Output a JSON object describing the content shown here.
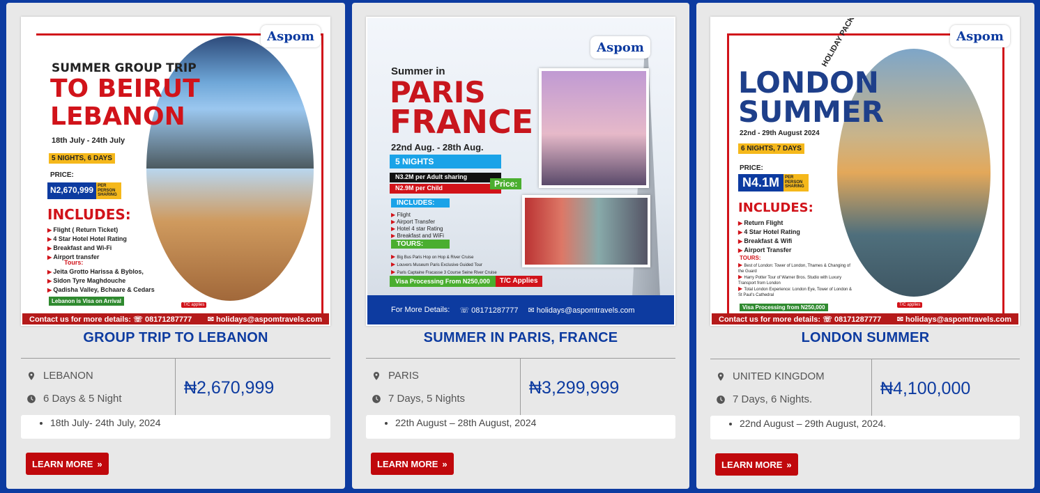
{
  "cards": [
    {
      "title": "GROUP TRIP TO LEBANON",
      "location": "LEBANON",
      "duration": "6 Days & 5 Night",
      "price": "₦2,670,999",
      "dates": "18th July- 24th July, 2024",
      "button": "LEARN MORE",
      "poster": {
        "logo": "Aspom",
        "line1": "SUMMER GROUP TRIP",
        "line2": "TO BEIRUT",
        "line3": "LEBANON",
        "dates": "18th July - 24th July",
        "nights": "5 NIGHTS, 6 DAYS",
        "price_label": "PRICE:",
        "price": "N2,670,999",
        "per": "PER PERSON SHARING",
        "includes": "INCLUDES:",
        "items": [
          "Flight ( Return Ticket)",
          "4 Star Hotel Hotel Rating",
          "Breakfast and Wi-Fi",
          "Airport transfer"
        ],
        "tours_label": "Tours:",
        "tours": [
          "Jeita Grotto Harissa & Byblos,",
          "Sidon Tyre Maghdouche",
          "Qadisha Valley, Bchaare & Cedars"
        ],
        "visa": "Lebanon is Visa on Arrival",
        "tc": "T/C applies",
        "contact": "Contact us for more details:",
        "phone": "08171287777",
        "email": "holidays@aspomtravels.com"
      }
    },
    {
      "title": "SUMMER IN PARIS, FRANCE",
      "location": "PARIS",
      "duration": "7 Days, 5 Nights",
      "price": "₦3,299,999",
      "dates": "22th August  – 28th August, 2024",
      "button": "LEARN MORE",
      "poster": {
        "logo": "Aspom",
        "line1": "Summer in",
        "line2": "PARIS",
        "line3": "FRANCE",
        "dates": "22nd Aug. - 28th Aug.",
        "nights": "5 NIGHTS",
        "adult": "N3.2M per Adult sharing",
        "child": "N2.9M per Child",
        "price_label": "Price:",
        "includes": "INCLUDES:",
        "items": [
          "Flight",
          "Airport Transfer",
          "Hotel 4 star Rating",
          "Breakfast and WiFi"
        ],
        "tours_label": "TOURS:",
        "tours": [
          "Big Bus Paris Hop on Hop & River Cruise",
          "Louvers Museum Paris Exclusive Guided Tour",
          "Paris Captaine Fracasse 3 Course Seine River Cruise"
        ],
        "visa": "Visa Processing From N250,000",
        "tc": "T/C Applies",
        "contact": "For More Details:",
        "phone": "08171287777",
        "email": "holidays@aspomtravels.com"
      }
    },
    {
      "title": "LONDON SUMMER",
      "location": "UNITED KINGDOM",
      "duration": "7 Days, 6 Nights.",
      "price": "₦4,100,000",
      "dates": "22nd August – 29th August, 2024.",
      "button": "LEARN MORE",
      "poster": {
        "logo": "Aspom",
        "line1": "LONDON",
        "line2": "SUMMER",
        "tag": "HOLIDAY PACKAGE",
        "dates": "22nd - 29th August 2024",
        "nights": "6 NIGHTS, 7 DAYS",
        "price_label": "PRICE:",
        "price": "N4.1M",
        "per": "PER PERSON SHARING",
        "includes": "INCLUDES:",
        "items": [
          "Return Flight",
          "4 Star Hotel Rating",
          "Breakfast & Wifi",
          "Airport Transfer"
        ],
        "tours_label": "TOURS:",
        "tours": [
          "Best of London: Tower of London, Thames & Changing of the Guard",
          "Harry Potter Tour of Warner Bros. Studio with Luxury Transport from London",
          "Total London Experience: London Eye, Tower of London & St Paul's Cathedral"
        ],
        "visa": "Visa Processing from N250,000",
        "tc": "T/C applies",
        "contact": "Contact us for more details:",
        "phone": "08171287777",
        "email": "holidays@aspomtravels.com"
      }
    }
  ],
  "colors": {
    "page_bg": "#0d3ba0",
    "title": "#0d3ba0",
    "button": "#c0080c",
    "accent_red": "#c8161d",
    "gold": "#f5b81b"
  },
  "icons": {
    "location": "map-marker-icon",
    "duration": "clock-icon",
    "button": "double-chevron-right-icon"
  }
}
